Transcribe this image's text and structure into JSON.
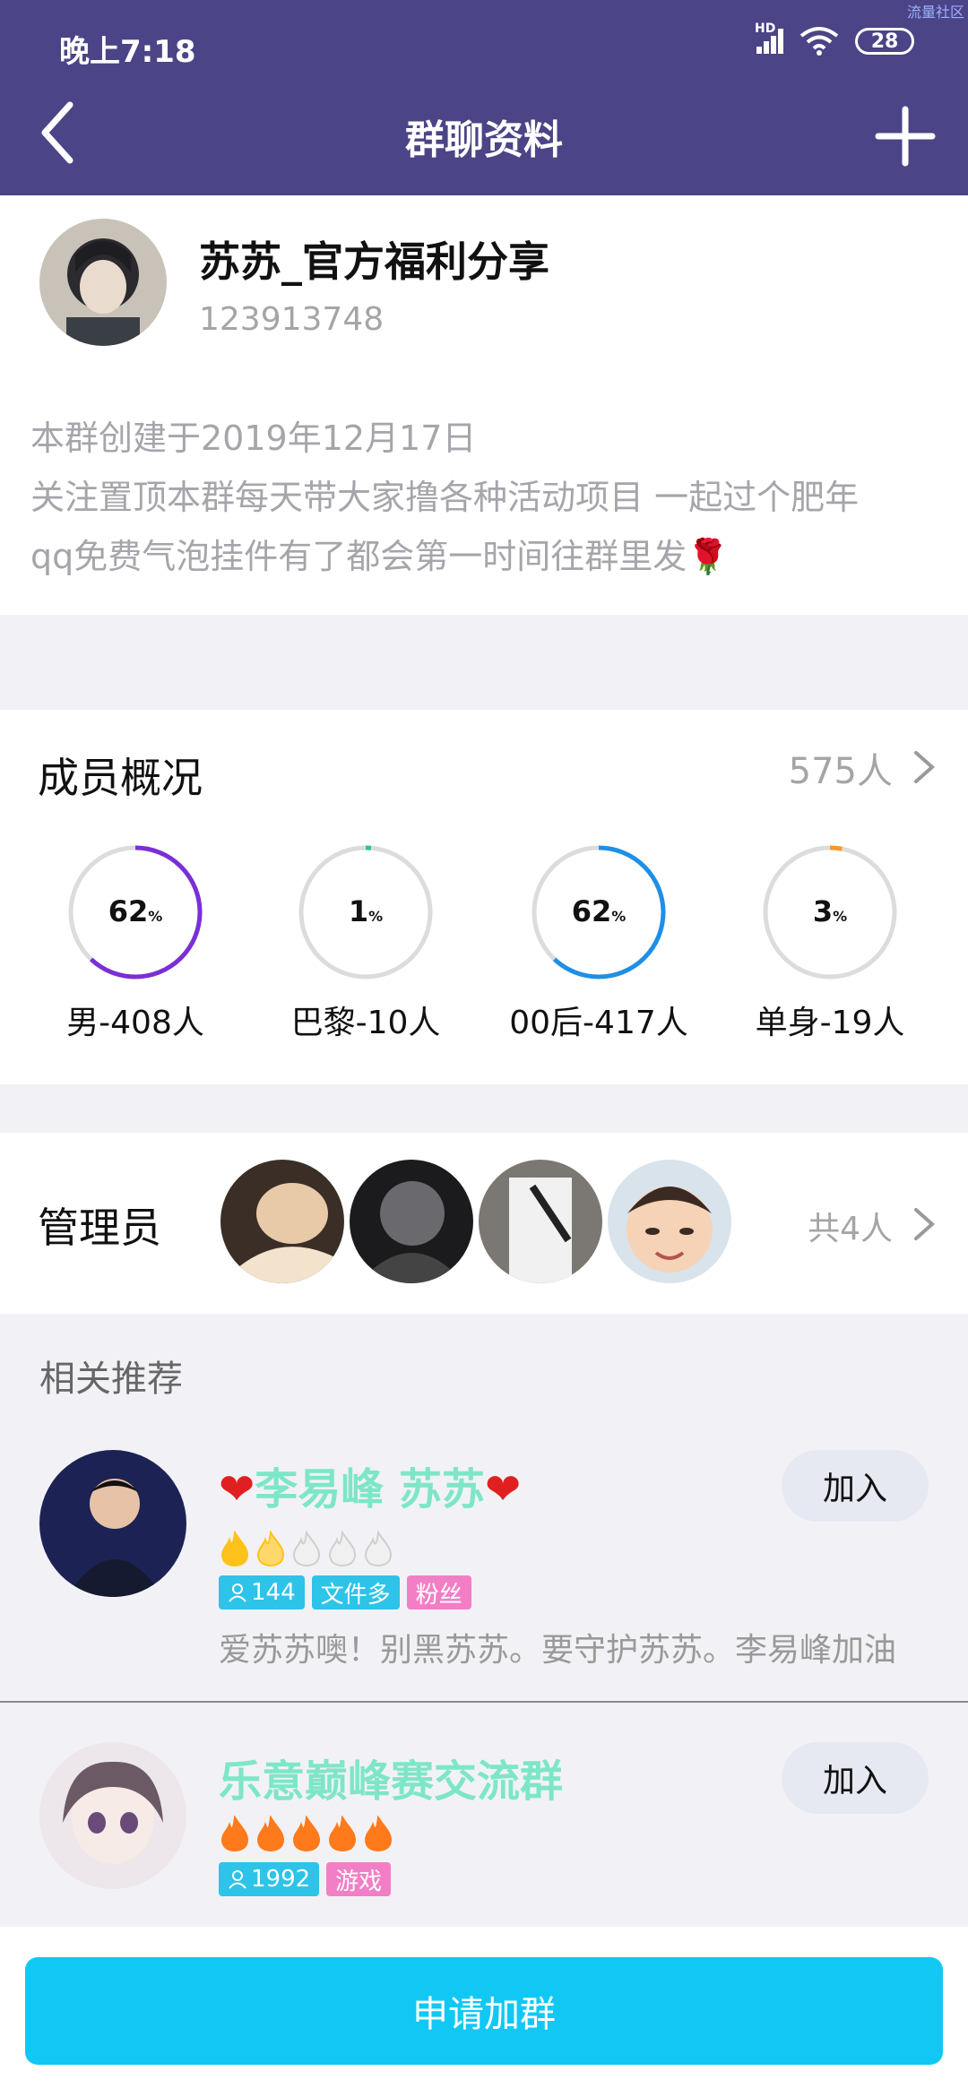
{
  "status_bar": {
    "time": "晚上7:18",
    "network": "HD",
    "battery": "28",
    "corner_mark": "流量社区"
  },
  "nav": {
    "title": "群聊资料",
    "back_icon": "chevron-left-icon",
    "add_icon": "plus-icon"
  },
  "group": {
    "name": "苏苏_官方福利分享",
    "id": "123913748",
    "desc_line1": "本群创建于2019年12月17日",
    "desc_line2": "关注置顶本群每天带大家撸各种活动项目 一起过个肥年",
    "desc_line3": "qq免费气泡挂件有了都会第一时间往群里发🌹"
  },
  "members": {
    "title": "成员概况",
    "count": "575人",
    "stats": [
      {
        "pct": 62,
        "label": "男-408人",
        "color": "#7a2fd6"
      },
      {
        "pct": 1,
        "label": "巴黎-10人",
        "color": "#29c49a"
      },
      {
        "pct": 62,
        "label": "00后-417人",
        "color": "#1f8fe6"
      },
      {
        "pct": 3,
        "label": "单身-19人",
        "color": "#f29b2a"
      }
    ],
    "pct_unit": "%"
  },
  "admins": {
    "title": "管理员",
    "count": "共4人",
    "avatars": [
      "admin-avatar-1",
      "admin-avatar-2",
      "admin-avatar-3",
      "admin-avatar-4"
    ]
  },
  "recommend": {
    "title": "相关推荐",
    "items": [
      {
        "heart_left": "❤",
        "name": "李易峰 苏苏",
        "heart_right": "❤",
        "members": "144",
        "tag2": "文件多",
        "tag3": "粉丝",
        "desc": "爱苏苏噢！别黑苏苏。要守护苏苏。李易峰加油",
        "join": "加入",
        "flames_active": 1.5
      },
      {
        "name": "乐意巅峰赛交流群",
        "members": "1992",
        "tag2": "游戏",
        "join": "加入",
        "flames_active": 5
      }
    ]
  },
  "bottom": {
    "apply": "申请加群"
  },
  "colors": {
    "header": "#4b4486",
    "apply": "#11c8f4",
    "rec_name": "#7ee6c8"
  }
}
